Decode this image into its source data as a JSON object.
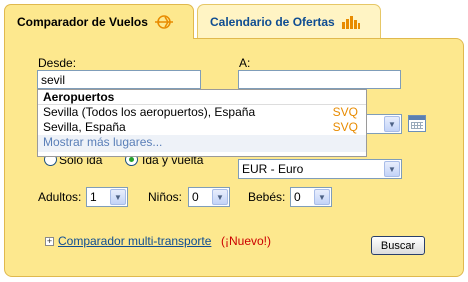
{
  "tabs": {
    "flights": {
      "label": "Comparador de Vuelos",
      "icon": "airplane-icon"
    },
    "offers": {
      "label": "Calendario de Ofertas",
      "icon": "bar-chart-icon"
    }
  },
  "form": {
    "from_label": "Desde:",
    "from_value": "sevil",
    "to_label": "A:",
    "to_value": "",
    "one_way_label": "Sólo ida",
    "round_trip_label": "Ida y vuelta",
    "currency": "EUR - Euro",
    "adults_label": "Adultos:",
    "adults_value": "1",
    "children_label": "Niños:",
    "children_value": "0",
    "infants_label": "Bebés:",
    "infants_value": "0",
    "multi_transport_link": "Comparador multi-transporte",
    "new_badge": "(¡Nuevo!)",
    "search_button": "Buscar"
  },
  "autocomplete": {
    "header": "Aeropuertos",
    "items": [
      {
        "name": "Sevilla (Todos los aeropuertos), España",
        "code": "SVQ"
      },
      {
        "name": "Sevilla, España",
        "code": "SVQ"
      }
    ],
    "more": "Mostrar más lugares..."
  },
  "colors": {
    "panel": "#fde88e",
    "border": "#e0b94e",
    "code": "#e88b00",
    "link": "#0f4d92"
  }
}
